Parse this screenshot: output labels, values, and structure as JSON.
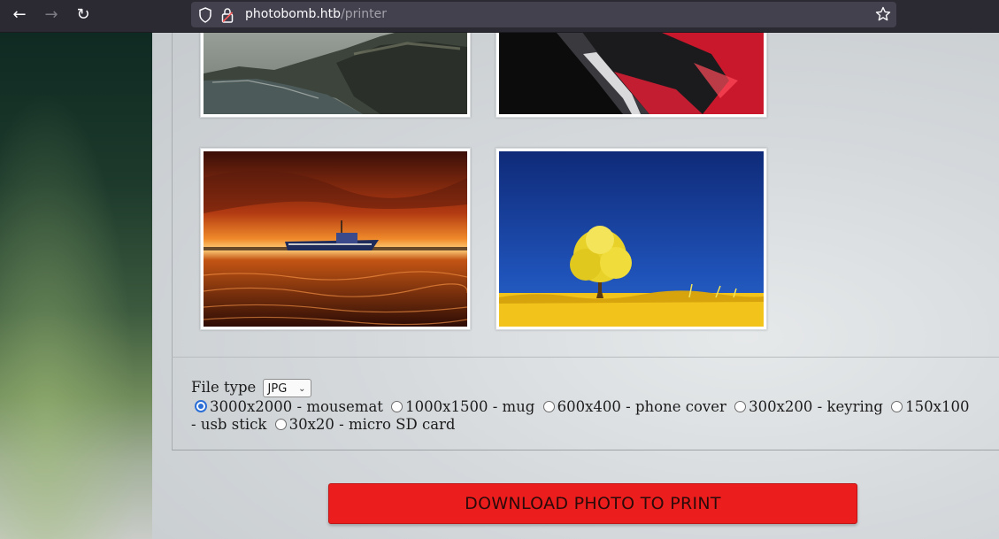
{
  "browser": {
    "url_host": "photobomb.htb",
    "url_path": "/printer",
    "icons": [
      "back-arrow-icon",
      "forward-arrow-icon",
      "reload-icon",
      "shield-icon",
      "lock-icon",
      "star-icon"
    ]
  },
  "gallery": {
    "images": [
      {
        "subject": "coastal cliffs"
      },
      {
        "subject": "red car detail"
      },
      {
        "subject": "boat at sunset"
      },
      {
        "subject": "yellow tree under blue sky"
      }
    ]
  },
  "form": {
    "file_type_label": "File type",
    "file_type_selected": "JPG",
    "sizes": [
      {
        "label": "3000x2000 - mousemat",
        "checked": true
      },
      {
        "label": "1000x1500 - mug",
        "checked": false
      },
      {
        "label": "600x400 - phone cover",
        "checked": false
      },
      {
        "label": "300x200 - keyring",
        "checked": false
      },
      {
        "label": "150x100 - usb stick",
        "checked": false
      },
      {
        "label": "30x20 - micro SD card",
        "checked": false
      }
    ],
    "download_label": "DOWNLOAD PHOTO TO PRINT"
  },
  "colors": {
    "download_button": "#ec1d1d",
    "radio_checked": "#2b6fd6",
    "toolbar": "#2b2a33"
  }
}
